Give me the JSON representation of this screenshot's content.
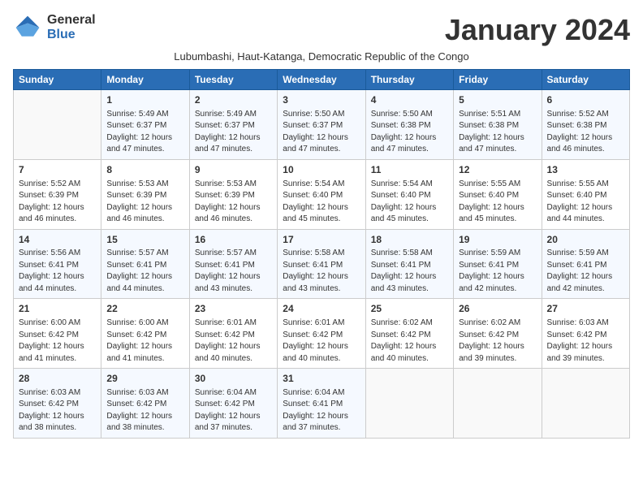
{
  "header": {
    "logo_general": "General",
    "logo_blue": "Blue",
    "month_title": "January 2024",
    "subtitle": "Lubumbashi, Haut-Katanga, Democratic Republic of the Congo"
  },
  "weekdays": [
    "Sunday",
    "Monday",
    "Tuesday",
    "Wednesday",
    "Thursday",
    "Friday",
    "Saturday"
  ],
  "weeks": [
    [
      {
        "day": "",
        "sunrise": "",
        "sunset": "",
        "daylight": ""
      },
      {
        "day": "1",
        "sunrise": "Sunrise: 5:49 AM",
        "sunset": "Sunset: 6:37 PM",
        "daylight": "Daylight: 12 hours and 47 minutes."
      },
      {
        "day": "2",
        "sunrise": "Sunrise: 5:49 AM",
        "sunset": "Sunset: 6:37 PM",
        "daylight": "Daylight: 12 hours and 47 minutes."
      },
      {
        "day": "3",
        "sunrise": "Sunrise: 5:50 AM",
        "sunset": "Sunset: 6:37 PM",
        "daylight": "Daylight: 12 hours and 47 minutes."
      },
      {
        "day": "4",
        "sunrise": "Sunrise: 5:50 AM",
        "sunset": "Sunset: 6:38 PM",
        "daylight": "Daylight: 12 hours and 47 minutes."
      },
      {
        "day": "5",
        "sunrise": "Sunrise: 5:51 AM",
        "sunset": "Sunset: 6:38 PM",
        "daylight": "Daylight: 12 hours and 47 minutes."
      },
      {
        "day": "6",
        "sunrise": "Sunrise: 5:52 AM",
        "sunset": "Sunset: 6:38 PM",
        "daylight": "Daylight: 12 hours and 46 minutes."
      }
    ],
    [
      {
        "day": "7",
        "sunrise": "Sunrise: 5:52 AM",
        "sunset": "Sunset: 6:39 PM",
        "daylight": "Daylight: 12 hours and 46 minutes."
      },
      {
        "day": "8",
        "sunrise": "Sunrise: 5:53 AM",
        "sunset": "Sunset: 6:39 PM",
        "daylight": "Daylight: 12 hours and 46 minutes."
      },
      {
        "day": "9",
        "sunrise": "Sunrise: 5:53 AM",
        "sunset": "Sunset: 6:39 PM",
        "daylight": "Daylight: 12 hours and 46 minutes."
      },
      {
        "day": "10",
        "sunrise": "Sunrise: 5:54 AM",
        "sunset": "Sunset: 6:40 PM",
        "daylight": "Daylight: 12 hours and 45 minutes."
      },
      {
        "day": "11",
        "sunrise": "Sunrise: 5:54 AM",
        "sunset": "Sunset: 6:40 PM",
        "daylight": "Daylight: 12 hours and 45 minutes."
      },
      {
        "day": "12",
        "sunrise": "Sunrise: 5:55 AM",
        "sunset": "Sunset: 6:40 PM",
        "daylight": "Daylight: 12 hours and 45 minutes."
      },
      {
        "day": "13",
        "sunrise": "Sunrise: 5:55 AM",
        "sunset": "Sunset: 6:40 PM",
        "daylight": "Daylight: 12 hours and 44 minutes."
      }
    ],
    [
      {
        "day": "14",
        "sunrise": "Sunrise: 5:56 AM",
        "sunset": "Sunset: 6:41 PM",
        "daylight": "Daylight: 12 hours and 44 minutes."
      },
      {
        "day": "15",
        "sunrise": "Sunrise: 5:57 AM",
        "sunset": "Sunset: 6:41 PM",
        "daylight": "Daylight: 12 hours and 44 minutes."
      },
      {
        "day": "16",
        "sunrise": "Sunrise: 5:57 AM",
        "sunset": "Sunset: 6:41 PM",
        "daylight": "Daylight: 12 hours and 43 minutes."
      },
      {
        "day": "17",
        "sunrise": "Sunrise: 5:58 AM",
        "sunset": "Sunset: 6:41 PM",
        "daylight": "Daylight: 12 hours and 43 minutes."
      },
      {
        "day": "18",
        "sunrise": "Sunrise: 5:58 AM",
        "sunset": "Sunset: 6:41 PM",
        "daylight": "Daylight: 12 hours and 43 minutes."
      },
      {
        "day": "19",
        "sunrise": "Sunrise: 5:59 AM",
        "sunset": "Sunset: 6:41 PM",
        "daylight": "Daylight: 12 hours and 42 minutes."
      },
      {
        "day": "20",
        "sunrise": "Sunrise: 5:59 AM",
        "sunset": "Sunset: 6:41 PM",
        "daylight": "Daylight: 12 hours and 42 minutes."
      }
    ],
    [
      {
        "day": "21",
        "sunrise": "Sunrise: 6:00 AM",
        "sunset": "Sunset: 6:42 PM",
        "daylight": "Daylight: 12 hours and 41 minutes."
      },
      {
        "day": "22",
        "sunrise": "Sunrise: 6:00 AM",
        "sunset": "Sunset: 6:42 PM",
        "daylight": "Daylight: 12 hours and 41 minutes."
      },
      {
        "day": "23",
        "sunrise": "Sunrise: 6:01 AM",
        "sunset": "Sunset: 6:42 PM",
        "daylight": "Daylight: 12 hours and 40 minutes."
      },
      {
        "day": "24",
        "sunrise": "Sunrise: 6:01 AM",
        "sunset": "Sunset: 6:42 PM",
        "daylight": "Daylight: 12 hours and 40 minutes."
      },
      {
        "day": "25",
        "sunrise": "Sunrise: 6:02 AM",
        "sunset": "Sunset: 6:42 PM",
        "daylight": "Daylight: 12 hours and 40 minutes."
      },
      {
        "day": "26",
        "sunrise": "Sunrise: 6:02 AM",
        "sunset": "Sunset: 6:42 PM",
        "daylight": "Daylight: 12 hours and 39 minutes."
      },
      {
        "day": "27",
        "sunrise": "Sunrise: 6:03 AM",
        "sunset": "Sunset: 6:42 PM",
        "daylight": "Daylight: 12 hours and 39 minutes."
      }
    ],
    [
      {
        "day": "28",
        "sunrise": "Sunrise: 6:03 AM",
        "sunset": "Sunset: 6:42 PM",
        "daylight": "Daylight: 12 hours and 38 minutes."
      },
      {
        "day": "29",
        "sunrise": "Sunrise: 6:03 AM",
        "sunset": "Sunset: 6:42 PM",
        "daylight": "Daylight: 12 hours and 38 minutes."
      },
      {
        "day": "30",
        "sunrise": "Sunrise: 6:04 AM",
        "sunset": "Sunset: 6:42 PM",
        "daylight": "Daylight: 12 hours and 37 minutes."
      },
      {
        "day": "31",
        "sunrise": "Sunrise: 6:04 AM",
        "sunset": "Sunset: 6:41 PM",
        "daylight": "Daylight: 12 hours and 37 minutes."
      },
      {
        "day": "",
        "sunrise": "",
        "sunset": "",
        "daylight": ""
      },
      {
        "day": "",
        "sunrise": "",
        "sunset": "",
        "daylight": ""
      },
      {
        "day": "",
        "sunrise": "",
        "sunset": "",
        "daylight": ""
      }
    ]
  ]
}
